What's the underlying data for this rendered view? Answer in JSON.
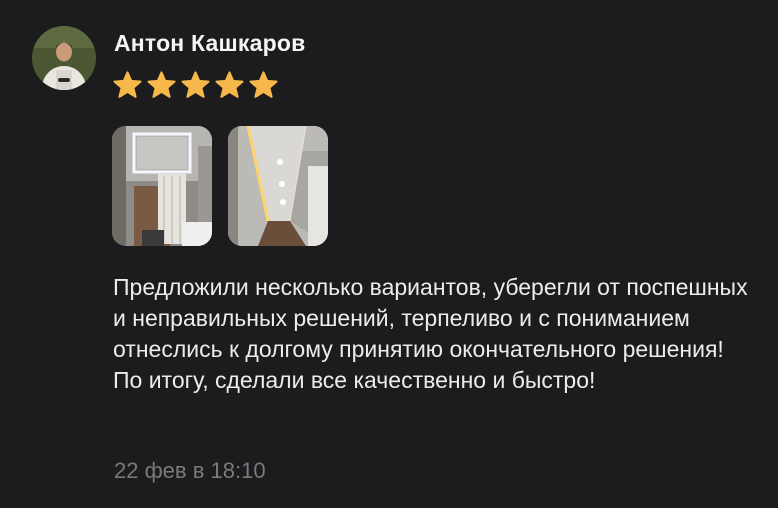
{
  "review": {
    "author": "Антон Кашкаров",
    "rating": 5,
    "rating_max": 5,
    "star_color": "#f7b84b",
    "photos": [
      {
        "name": "review-photo-1",
        "icon": "bathroom-ceiling-photo"
      },
      {
        "name": "review-photo-2",
        "icon": "corridor-ceiling-photo"
      }
    ],
    "text": "Предложили несколько вариантов, уберегли от поспешных и неправильных решений, терпеливо и с пониманием отнеслись к долгому принятию окончательного решения! По итогу, сделали все качественно и быстро!",
    "date": "22 фев в 18:10"
  },
  "colors": {
    "background": "#1c1c1e",
    "text": "#ececec",
    "muted": "#7a7a7d"
  }
}
